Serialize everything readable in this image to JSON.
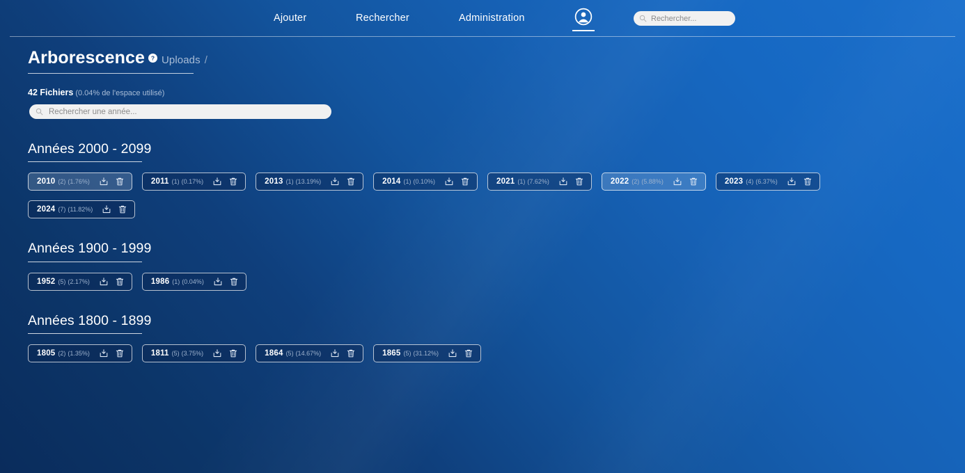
{
  "nav": {
    "links": [
      {
        "label": "Ajouter",
        "name": "nav-link-ajouter"
      },
      {
        "label": "Rechercher",
        "name": "nav-link-rechercher"
      },
      {
        "label": "Administration",
        "name": "nav-link-administration"
      }
    ],
    "account_icon": "user-account-icon",
    "search": {
      "placeholder": "Rechercher...",
      "value": "",
      "icon": "search-icon"
    }
  },
  "header": {
    "title": "Arborescence",
    "help_icon": "help-question-icon",
    "breadcrumb": "Uploads",
    "breadcrumb_separator": "/"
  },
  "summary": {
    "count_label": "42 Fichiers",
    "space_label": "(0.04% de l'espace utilisé)"
  },
  "year_search": {
    "placeholder": "Rechercher une année...",
    "value": "",
    "icon": "search-icon"
  },
  "icons": {
    "download": "download-icon",
    "delete": "trash-icon"
  },
  "colors": {
    "bg_dark": "#0a2c5c",
    "bg_light": "#1a6fcc",
    "text": "#ffffff",
    "muted": "#9db2cd",
    "chip_border": "rgba(255,255,255,0.70)"
  },
  "groups": [
    {
      "title": "Années 2000 - 2099",
      "years": [
        {
          "year": "2010",
          "count": "(2)",
          "pct": "(1.76%)",
          "highlight": true
        },
        {
          "year": "2011",
          "count": "(1)",
          "pct": "(0.17%)",
          "highlight": false
        },
        {
          "year": "2013",
          "count": "(1)",
          "pct": "(13.19%)",
          "highlight": false
        },
        {
          "year": "2014",
          "count": "(1)",
          "pct": "(0.10%)",
          "highlight": false
        },
        {
          "year": "2021",
          "count": "(1)",
          "pct": "(7.62%)",
          "highlight": false
        },
        {
          "year": "2022",
          "count": "(2)",
          "pct": "(5.88%)",
          "highlight": true
        },
        {
          "year": "2023",
          "count": "(4)",
          "pct": "(6.37%)",
          "highlight": false
        },
        {
          "year": "2024",
          "count": "(7)",
          "pct": "(11.82%)",
          "highlight": false
        }
      ]
    },
    {
      "title": "Années 1900 - 1999",
      "years": [
        {
          "year": "1952",
          "count": "(5)",
          "pct": "(2.17%)",
          "highlight": false
        },
        {
          "year": "1986",
          "count": "(1)",
          "pct": "(0.04%)",
          "highlight": false
        }
      ]
    },
    {
      "title": "Années 1800 - 1899",
      "years": [
        {
          "year": "1805",
          "count": "(2)",
          "pct": "(1.35%)",
          "highlight": false
        },
        {
          "year": "1811",
          "count": "(5)",
          "pct": "(3.75%)",
          "highlight": false
        },
        {
          "year": "1864",
          "count": "(5)",
          "pct": "(14.67%)",
          "highlight": false
        },
        {
          "year": "1865",
          "count": "(5)",
          "pct": "(31.12%)",
          "highlight": false
        }
      ]
    }
  ]
}
